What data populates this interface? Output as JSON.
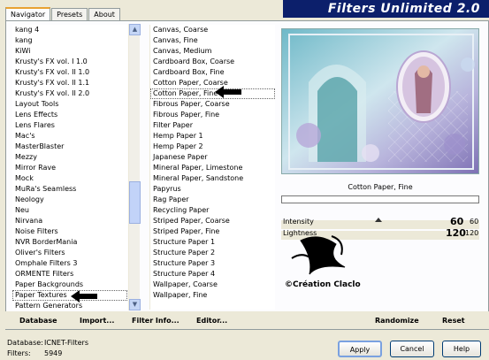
{
  "app": {
    "title": "Filters Unlimited 2.0"
  },
  "tabs": [
    {
      "label": "Navigator"
    },
    {
      "label": "Presets"
    },
    {
      "label": "About"
    }
  ],
  "categories": [
    "kang 4",
    "kang",
    "KiWi",
    "Krusty's FX vol. I 1.0",
    "Krusty's FX vol. II 1.0",
    "Krusty's FX vol. II 1.1",
    "Krusty's FX vol. II 2.0",
    "Layout Tools",
    "Lens Effects",
    "Lens Flares",
    "Mac's",
    "MasterBlaster",
    "Mezzy",
    "Mirror Rave",
    "Mock",
    "MuRa's Seamless",
    "Neology",
    "Neu",
    "Nirvana",
    "Noise Filters",
    "NVR BorderMania",
    "Oliver's Filters",
    "Omphale Filters 3",
    "ORMENTE Filters",
    "Paper Backgrounds",
    "Paper Textures",
    "Pattern Generators"
  ],
  "selected_category": "Paper Textures",
  "filters": [
    "Canvas, Coarse",
    "Canvas, Fine",
    "Canvas, Medium",
    "Cardboard Box, Coarse",
    "Cardboard Box, Fine",
    "Cotton Paper, Coarse",
    "Cotton Paper, Fine",
    "Fibrous Paper, Coarse",
    "Fibrous Paper, Fine",
    "Filter Paper",
    "Hemp Paper 1",
    "Hemp Paper 2",
    "Japanese Paper",
    "Mineral Paper, Limestone",
    "Mineral Paper, Sandstone",
    "Papyrus",
    "Rag Paper",
    "Recycling Paper",
    "Striped Paper, Coarse",
    "Striped Paper, Fine",
    "Structure Paper 1",
    "Structure Paper 2",
    "Structure Paper 3",
    "Structure Paper 4",
    "Wallpaper, Coarse",
    "Wallpaper, Fine"
  ],
  "selected_filter": "Cotton Paper, Fine",
  "buttons": {
    "database": "Database",
    "import": "Import...",
    "filter_info": "Filter Info...",
    "editor": "Editor...",
    "randomize": "Randomize",
    "reset": "Reset",
    "apply": "Apply",
    "cancel": "Cancel",
    "help": "Help"
  },
  "preview": {
    "filter_name": "Cotton Paper, Fine",
    "watermark": "©Création Claclo"
  },
  "sliders": [
    {
      "label": "Intensity",
      "value": "60",
      "value_small": "60"
    },
    {
      "label": "Lightness",
      "value": "120",
      "value_small": "120"
    }
  ],
  "status": {
    "database_label": "Database:",
    "database_value": "ICNET-Filters",
    "filters_label": "Filters:",
    "filters_value": "5949"
  },
  "colors": {
    "title_bg": "#0c1f6b",
    "accent": "#e8a232",
    "panel": "#ece9d8"
  }
}
